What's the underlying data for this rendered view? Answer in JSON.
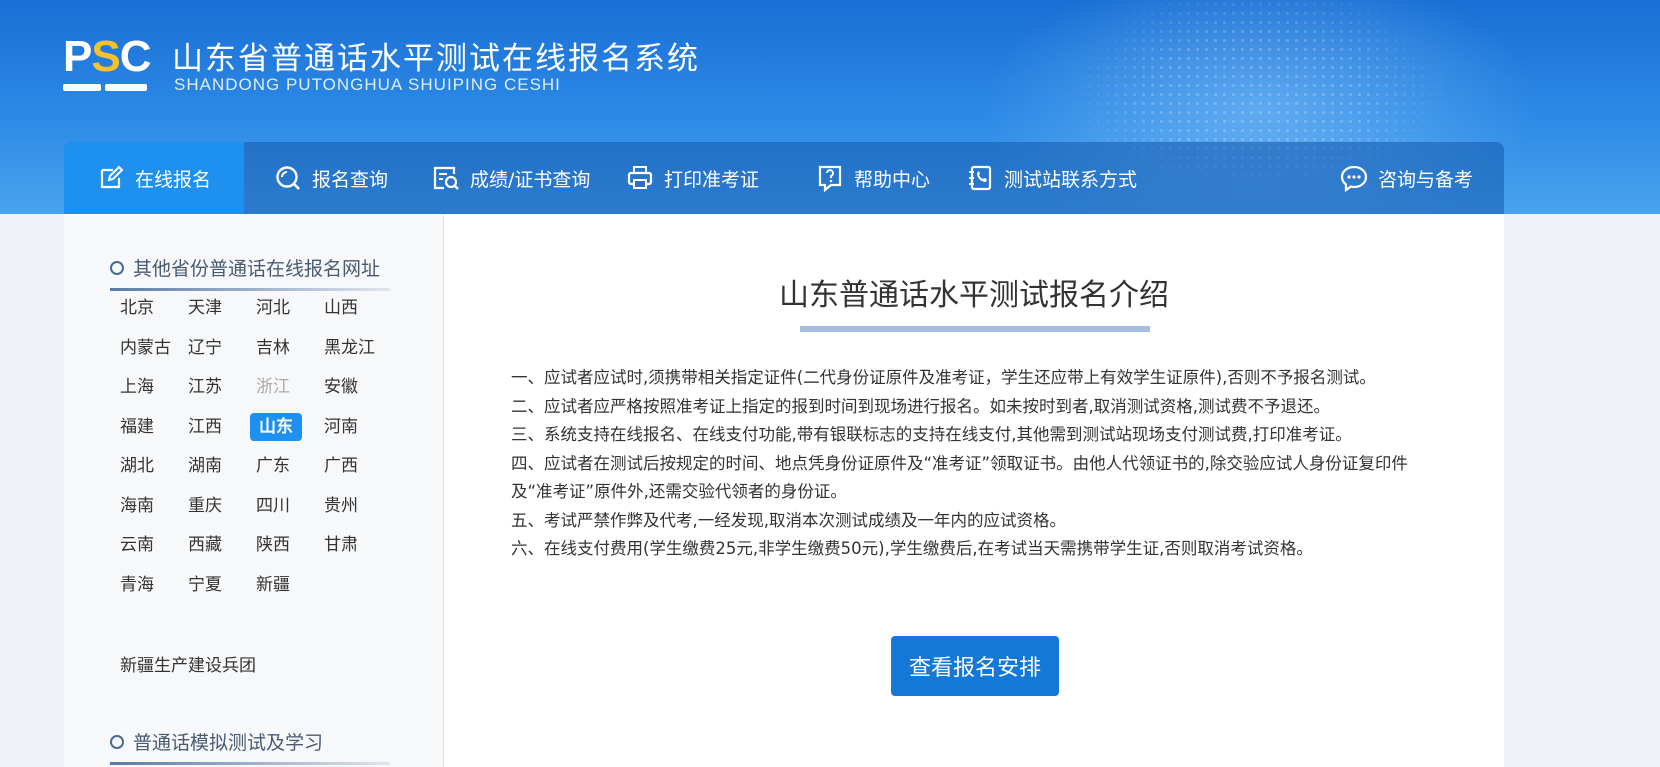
{
  "header": {
    "logo_text": "PSC",
    "title": "山东省普通话水平测试在线报名系统",
    "subtitle": "SHANDONG PUTONGHUA SHUIPING CESHI"
  },
  "nav": {
    "items": [
      {
        "label": "在线报名",
        "icon": "edit-icon"
      },
      {
        "label": "报名查询",
        "icon": "search-icon"
      },
      {
        "label": "成绩/证书查询",
        "icon": "certificate-search-icon"
      },
      {
        "label": "打印准考证",
        "icon": "printer-icon"
      },
      {
        "label": "帮助中心",
        "icon": "help-icon"
      },
      {
        "label": "测试站联系方式",
        "icon": "phone-book-icon"
      },
      {
        "label": "咨询与备考",
        "icon": "chat-icon"
      }
    ],
    "active": "在线报名"
  },
  "sidebar": {
    "section1_title": "其他省份普通话在线报名网址",
    "provinces": [
      "北京",
      "天津",
      "河北",
      "山西",
      "内蒙古",
      "辽宁",
      "吉林",
      "黑龙江",
      "上海",
      "江苏",
      "浙江",
      "安徽",
      "福建",
      "江西",
      "山东",
      "河南",
      "湖北",
      "湖南",
      "广东",
      "广西",
      "海南",
      "重庆",
      "四川",
      "贵州",
      "云南",
      "西藏",
      "陕西",
      "甘肃",
      "青海",
      "宁夏",
      "新疆"
    ],
    "selected_province": "山东",
    "disabled_province": "浙江",
    "extra_link": "新疆生产建设兵团",
    "section2_title": "普通话模拟测试及学习"
  },
  "content": {
    "title": "山东普通话水平测试报名介绍",
    "rules": [
      "一、应试者应试时,须携带相关指定证件(二代身份证原件及准考证，学生还应带上有效学生证原件),否则不予报名测试。",
      "二、应试者应严格按照准考证上指定的报到时间到现场进行报名。如未按时到者,取消测试资格,测试费不予退还。",
      "三、系统支持在线报名、在线支付功能,带有银联标志的支持在线支付,其他需到测试站现场支付测试费,打印准考证。",
      "四、应试者在测试后按规定的时间、地点凭身份证原件及“准考证”领取证书。由他人代领证书的,除交验应试人身份证复印件及“准考证”原件外,还需交验代领者的身份证。",
      "五、考试严禁作弊及代考,一经发现,取消本次测试成绩及一年内的应试资格。",
      "六、在线支付费用(学生缴费25元,非学生缴费50元),学生缴费后,在考试当天需携带学生证,否则取消考试资格。"
    ],
    "button_label": "查看报名安排"
  },
  "colors": {
    "banner": "#2c8ae6",
    "nav_active": "#1e90f0",
    "button": "#1479d6",
    "logo_accent": "#f6c12c"
  }
}
